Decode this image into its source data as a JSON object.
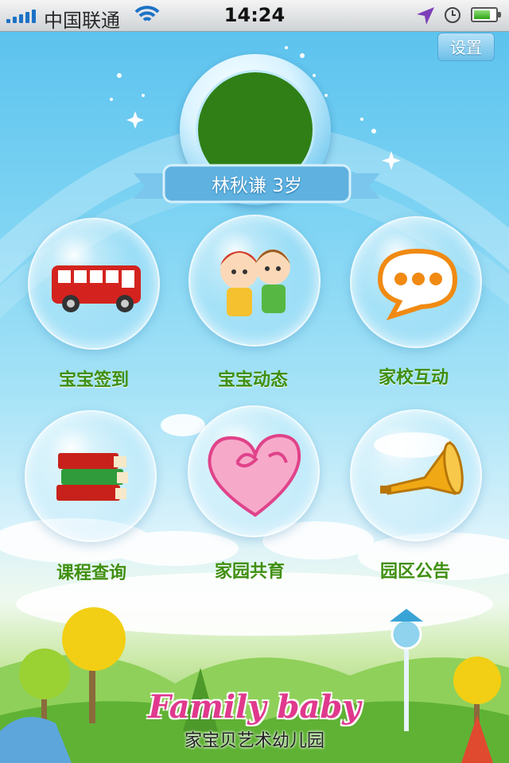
{
  "status_bar": {
    "carrier": "中国联通",
    "time": "14:24",
    "battery_level": 0.75,
    "signal_bars": 5
  },
  "header": {
    "settings_label": "设置"
  },
  "profile": {
    "name_age": "林秋谦   3岁"
  },
  "menu": {
    "items": [
      {
        "label": "宝宝签到",
        "icon": "bus-icon"
      },
      {
        "label": "宝宝动态",
        "icon": "kids-icon"
      },
      {
        "label": "家校互动",
        "icon": "chat-bubble-icon"
      },
      {
        "label": "课程查询",
        "icon": "books-icon"
      },
      {
        "label": "家园共育",
        "icon": "heart-icon"
      },
      {
        "label": "园区公告",
        "icon": "trumpet-icon"
      }
    ]
  },
  "footer": {
    "logo_text": "Family baby",
    "school_name": "家宝贝艺术幼儿园"
  },
  "colors": {
    "label_green": "#3f8f10",
    "sky_blue": "#5cc3ee",
    "avatar_green": "#2f7f16"
  }
}
